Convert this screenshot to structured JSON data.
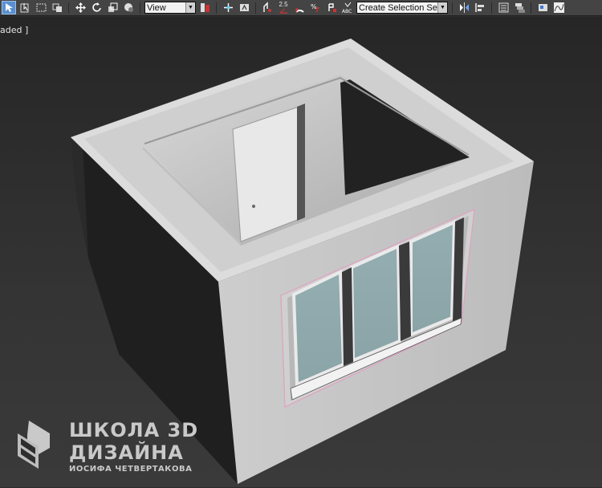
{
  "toolbar": {
    "reference_coordinate_system": "View",
    "snap_angle_label": "2.5",
    "named_selection_placeholder": "Create Selection Se",
    "icons": [
      "select-object-icon",
      "select-by-name-icon",
      "rectangular-selection-region-icon",
      "window-crossing-icon",
      "select-and-move-icon",
      "select-and-rotate-icon",
      "select-and-scale-icon",
      "select-and-place-icon",
      "use-pivot-point-center-icon",
      "select-and-manipulate-icon",
      "keyboard-shortcut-override-icon",
      "snaps-toggle-icon",
      "angle-snap-toggle-icon",
      "percent-snap-toggle-icon",
      "spinner-snap-toggle-icon",
      "edit-named-selection-sets-icon",
      "mirror-icon",
      "align-icon",
      "toggle-scene-explorer-icon",
      "toggle-layer-explorer-icon",
      "toggle-ribbon-icon",
      "curve-editor-icon"
    ]
  },
  "viewport": {
    "label": "aded ]"
  },
  "watermark": {
    "line1": "ШКОЛА 3D",
    "line2": "ДИЗАЙНА",
    "line3": "ИОСИФА ЧЕТВЕРТАКОВА"
  },
  "colors": {
    "toolbar_bg": "#444444",
    "viewport_bg": "#2e2e2e",
    "wall_front": "#c4c4c4",
    "wall_left": "#1e1e1e",
    "wall_top": "#d6d6d6",
    "glass": "#8fa9ad",
    "selection_outline": "#e0a0c0"
  }
}
